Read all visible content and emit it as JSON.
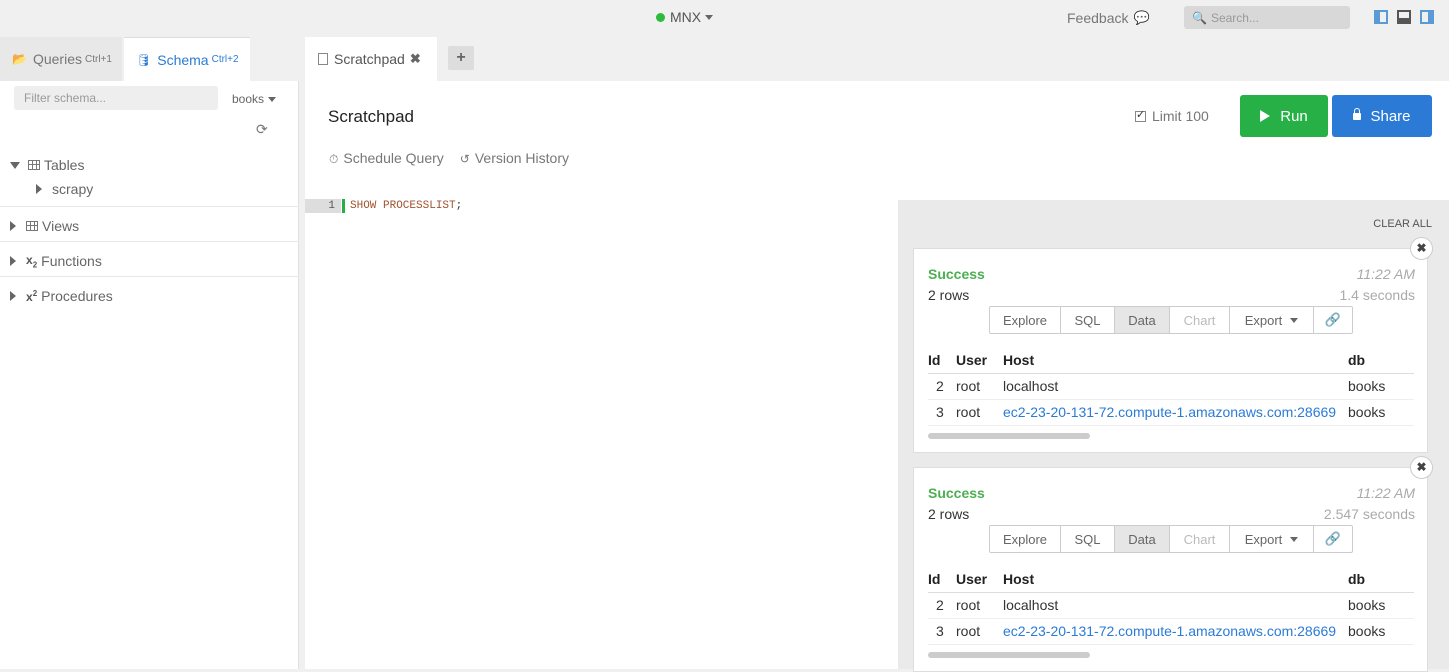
{
  "topbar": {
    "connection": "MNX",
    "feedback": "Feedback",
    "search_placeholder": "Search..."
  },
  "left_tabs": [
    {
      "label": "Queries",
      "shortcut": "Ctrl+1"
    },
    {
      "label": "Schema",
      "shortcut": "Ctrl+2"
    }
  ],
  "sidebar": {
    "filter_placeholder": "Filter schema...",
    "database": "books",
    "tree": [
      {
        "label": "Tables",
        "expanded": true,
        "children": [
          "scrapy"
        ]
      },
      {
        "label": "Views"
      },
      {
        "label": "Functions"
      },
      {
        "label": "Procedures"
      }
    ]
  },
  "editor_tab": {
    "label": "Scratchpad"
  },
  "main": {
    "title": "Scratchpad",
    "limit_label": "Limit 100",
    "run_label": "Run",
    "share_label": "Share",
    "schedule_label": "Schedule Query",
    "history_label": "Version History"
  },
  "editor": {
    "line_number": "1",
    "code_keyword": "SHOW PROCESSLIST",
    "code_punct": ";"
  },
  "results": {
    "clear_all": "CLEAR ALL",
    "cards": [
      {
        "status": "Success",
        "time": "11:22 AM",
        "rows": "2 rows",
        "duration": "1.4 seconds",
        "buttons": [
          "Explore",
          "SQL",
          "Data",
          "Chart",
          "Export"
        ],
        "columns": [
          "Id",
          "User",
          "Host",
          "db"
        ],
        "data": [
          [
            "2",
            "root",
            "localhost",
            "books"
          ],
          [
            "3",
            "root",
            "ec2-23-20-131-72.compute-1.amazonaws.com:28669",
            "books"
          ]
        ]
      },
      {
        "status": "Success",
        "time": "11:22 AM",
        "rows": "2 rows",
        "duration": "2.547 seconds",
        "buttons": [
          "Explore",
          "SQL",
          "Data",
          "Chart",
          "Export"
        ],
        "columns": [
          "Id",
          "User",
          "Host",
          "db"
        ],
        "data": [
          [
            "2",
            "root",
            "localhost",
            "books"
          ],
          [
            "3",
            "root",
            "ec2-23-20-131-72.compute-1.amazonaws.com:28669",
            "books"
          ]
        ]
      }
    ]
  },
  "colors": {
    "accent_blue": "#2b7bd6",
    "run_green": "#27b045",
    "success_green": "#4caf50"
  }
}
